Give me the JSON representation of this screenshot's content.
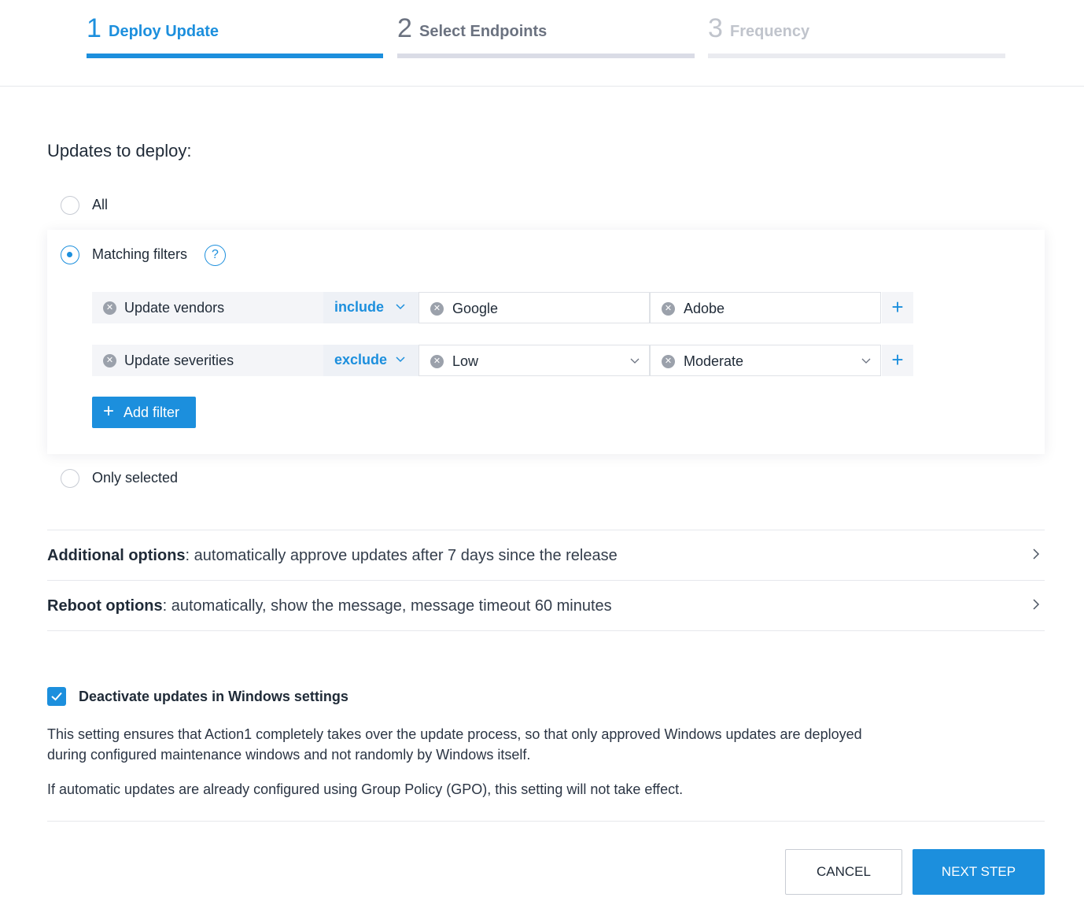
{
  "steps": [
    {
      "number": "1",
      "label": "Deploy Update",
      "state": "active"
    },
    {
      "number": "2",
      "label": "Select Endpoints",
      "state": "upcoming"
    },
    {
      "number": "3",
      "label": "Frequency",
      "state": "disabled"
    }
  ],
  "updates": {
    "title": "Updates to deploy:",
    "options": {
      "all": "All",
      "matching": "Matching filters",
      "only_selected": "Only selected"
    },
    "selected": "matching",
    "help_icon_glyph": "?"
  },
  "filters": [
    {
      "name": "Update vendors",
      "operator": "include",
      "values": [
        "Google",
        "Adobe"
      ]
    },
    {
      "name": "Update severities",
      "operator": "exclude",
      "values": [
        "Low",
        "Moderate"
      ]
    }
  ],
  "add_filter_label": "Add filter",
  "additional_options": {
    "label": "Additional options",
    "text": ": automatically approve updates after 7 days since the release"
  },
  "reboot_options": {
    "label": "Reboot options",
    "text": ": automatically, show the message, message timeout 60 minutes"
  },
  "deactivate": {
    "checked": true,
    "label": "Deactivate updates in Windows settings",
    "description_1": "This setting ensures that Action1 completely takes over the update process, so that only approved Windows updates are deployed during configured maintenance windows and not randomly by Windows itself.",
    "description_2": "If automatic updates are already configured using Group Policy (GPO), this setting will not take effect."
  },
  "buttons": {
    "cancel": "CANCEL",
    "next": "NEXT STEP"
  },
  "colors": {
    "accent": "#1c8fdd",
    "text": "#1f2a37",
    "muted": "#6b7280",
    "disabled": "#c0c4cc"
  }
}
